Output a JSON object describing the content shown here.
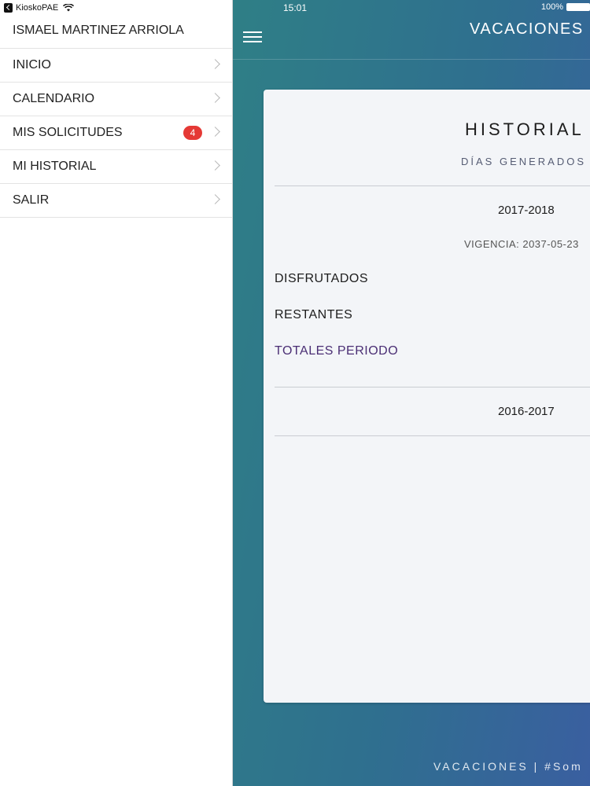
{
  "status_bar": {
    "app_name": "KioskoPAE",
    "time": "15:01",
    "battery": "100%"
  },
  "drawer": {
    "user_name": "ISMAEL MARTINEZ ARRIOLA",
    "items": [
      {
        "label": "INICIO"
      },
      {
        "label": "CALENDARIO"
      },
      {
        "label": "MIS SOLICITUDES",
        "badge": "4"
      },
      {
        "label": "MI HISTORIAL"
      },
      {
        "label": "SALIR"
      }
    ]
  },
  "header": {
    "title": "VACACIONES"
  },
  "card": {
    "title": "HISTORIAL",
    "subtitle": "DÍAS GENERADOS",
    "periods": [
      {
        "label": "2017-2018",
        "vigencia": "VIGENCIA: 2037-05-23",
        "rows": [
          "DISFRUTADOS",
          "RESTANTES",
          "TOTALES PERIODO"
        ]
      },
      {
        "label": "2016-2017"
      }
    ]
  },
  "footer": {
    "text": "VACACIONES  |  #Som"
  },
  "colors": {
    "badge": "#e53935",
    "accent_text": "#4a2e74",
    "gradient_start": "#2f7f86",
    "gradient_end": "#3a5fa0"
  }
}
